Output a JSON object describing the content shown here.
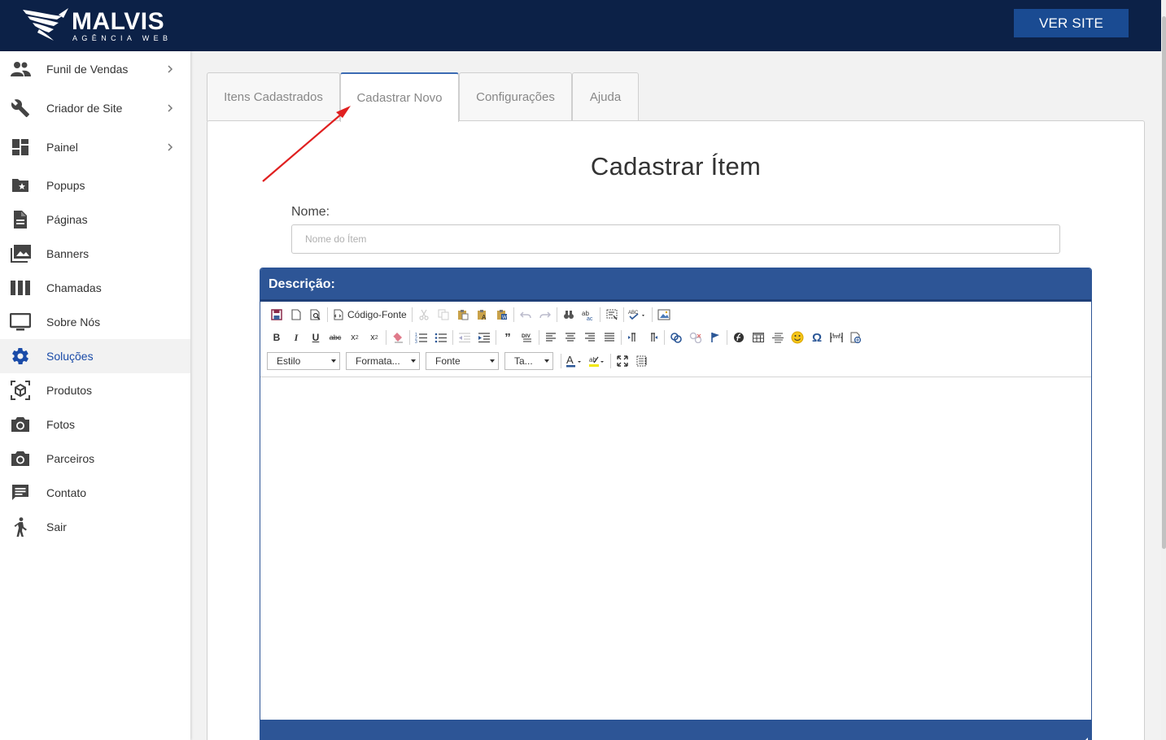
{
  "header": {
    "logo_text": "MALVIS",
    "logo_sub": "AGÊNCIA WEB",
    "ver_site_label": "VER SITE"
  },
  "sidebar": {
    "items": [
      {
        "label": "Funil de Vendas",
        "icon": "people-icon",
        "has_chevron": true
      },
      {
        "label": "Criador de Site",
        "icon": "wrench-icon",
        "has_chevron": true
      },
      {
        "label": "Painel",
        "icon": "dashboard-icon",
        "has_chevron": true
      },
      {
        "label": "Popups",
        "icon": "folder-star-icon",
        "has_chevron": false
      },
      {
        "label": "Páginas",
        "icon": "document-icon",
        "has_chevron": false
      },
      {
        "label": "Banners",
        "icon": "photo-library-icon",
        "has_chevron": false
      },
      {
        "label": "Chamadas",
        "icon": "columns-icon",
        "has_chevron": false
      },
      {
        "label": "Sobre Nós",
        "icon": "monitor-icon",
        "has_chevron": false
      },
      {
        "label": "Soluções",
        "icon": "gear-icon",
        "has_chevron": false,
        "active": true
      },
      {
        "label": "Produtos",
        "icon": "cube-icon",
        "has_chevron": false
      },
      {
        "label": "Fotos",
        "icon": "camera-icon",
        "has_chevron": false
      },
      {
        "label": "Parceiros",
        "icon": "camera-icon",
        "has_chevron": false
      },
      {
        "label": "Contato",
        "icon": "chat-icon",
        "has_chevron": false
      },
      {
        "label": "Sair",
        "icon": "walking-person-icon",
        "has_chevron": false
      }
    ]
  },
  "tabs": [
    {
      "label": "Itens Cadastrados"
    },
    {
      "label": "Cadastrar Novo",
      "active": true
    },
    {
      "label": "Configurações"
    },
    {
      "label": "Ajuda"
    }
  ],
  "form": {
    "title": "Cadastrar Ítem",
    "name_label": "Nome:",
    "name_placeholder": "Nome do Ítem",
    "name_value": ""
  },
  "editor": {
    "header": "Descrição:",
    "source_label": "Código-Fonte",
    "combos": {
      "style": "Estilo",
      "format": "Formata...",
      "font": "Fonte",
      "size": "Ta..."
    }
  },
  "colors": {
    "topbar": "#0c2147",
    "accent": "#1a4b92",
    "editor_header": "#2d5596",
    "active_nav": "#1a4ba8",
    "annotation_arrow": "#e02020"
  }
}
